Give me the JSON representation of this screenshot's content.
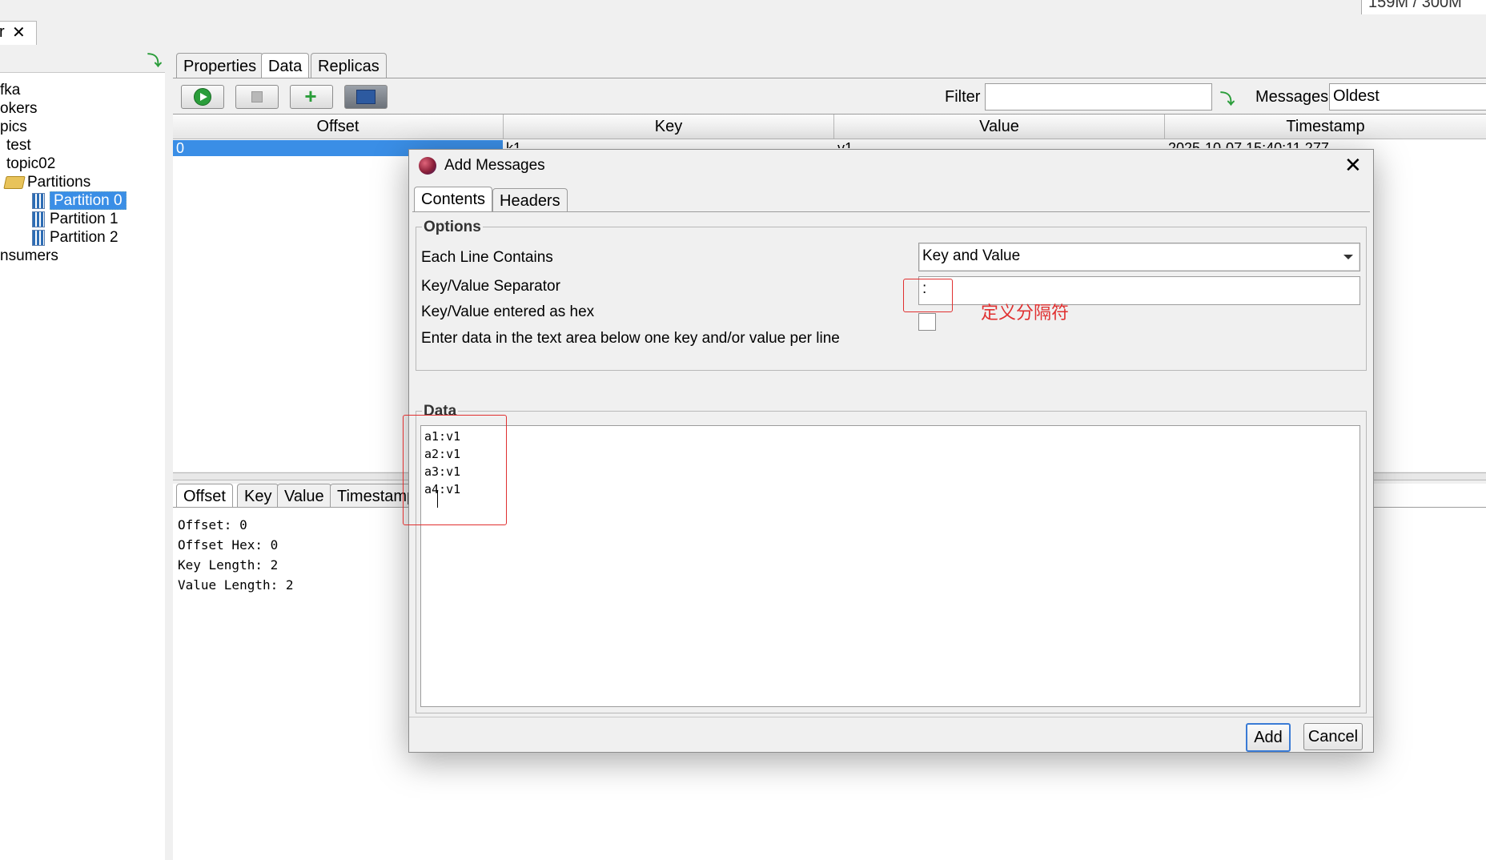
{
  "top": {
    "memory": "159M / 300M"
  },
  "doc_tab": {
    "label": "r",
    "close": "✕"
  },
  "tree": {
    "nodes": [
      {
        "label": "fka"
      },
      {
        "label": "okers"
      },
      {
        "label": "pics"
      },
      {
        "label": "test"
      },
      {
        "label": "topic02"
      },
      {
        "label": "Partitions"
      },
      {
        "label": "Partition 0"
      },
      {
        "label": "Partition 1"
      },
      {
        "label": "Partition 2"
      },
      {
        "label": "nsumers"
      }
    ]
  },
  "tabs": {
    "properties": "Properties",
    "data": "Data",
    "replicas": "Replicas"
  },
  "toolbar": {
    "filter_label": "Filter",
    "filter_value": "",
    "messages_label": "Messages",
    "messages_value": "Oldest"
  },
  "grid": {
    "columns": [
      "Offset",
      "Key",
      "Value",
      "Timestamp"
    ],
    "rows": [
      {
        "offset": "0",
        "key": "k1",
        "value": "v1",
        "timestamp": "2025-10-07 15:40:11.277"
      }
    ]
  },
  "detail": {
    "tabs": [
      "Offset",
      "Key",
      "Value",
      "Timestamp"
    ],
    "lines": [
      "Offset: 0",
      "Offset Hex: 0",
      "Key Length: 2",
      "Value Length: 2"
    ]
  },
  "dialog": {
    "title": "Add Messages",
    "close": "✕",
    "tabs": {
      "contents": "Contents",
      "headers": "Headers"
    },
    "options": {
      "legend": "Options",
      "each_line_label": "Each Line Contains",
      "each_line_value": "Key and Value",
      "separator_label": "Key/Value Separator",
      "separator_value": ":",
      "hex_label": "Key/Value entered as hex",
      "hex_checked": false,
      "hint": "Enter data in the text area below one key and/or value per line"
    },
    "annotation": "定义分隔符",
    "data": {
      "legend": "Data",
      "lines": [
        "a1:v1",
        "a2:v1",
        "a3:v1",
        "a4:v1"
      ]
    },
    "buttons": {
      "add": "Add",
      "cancel": "Cancel"
    }
  },
  "colors": {
    "selection": "#3a8ee6",
    "annotation": "#e03030",
    "accent_green": "#2a9d3a"
  }
}
